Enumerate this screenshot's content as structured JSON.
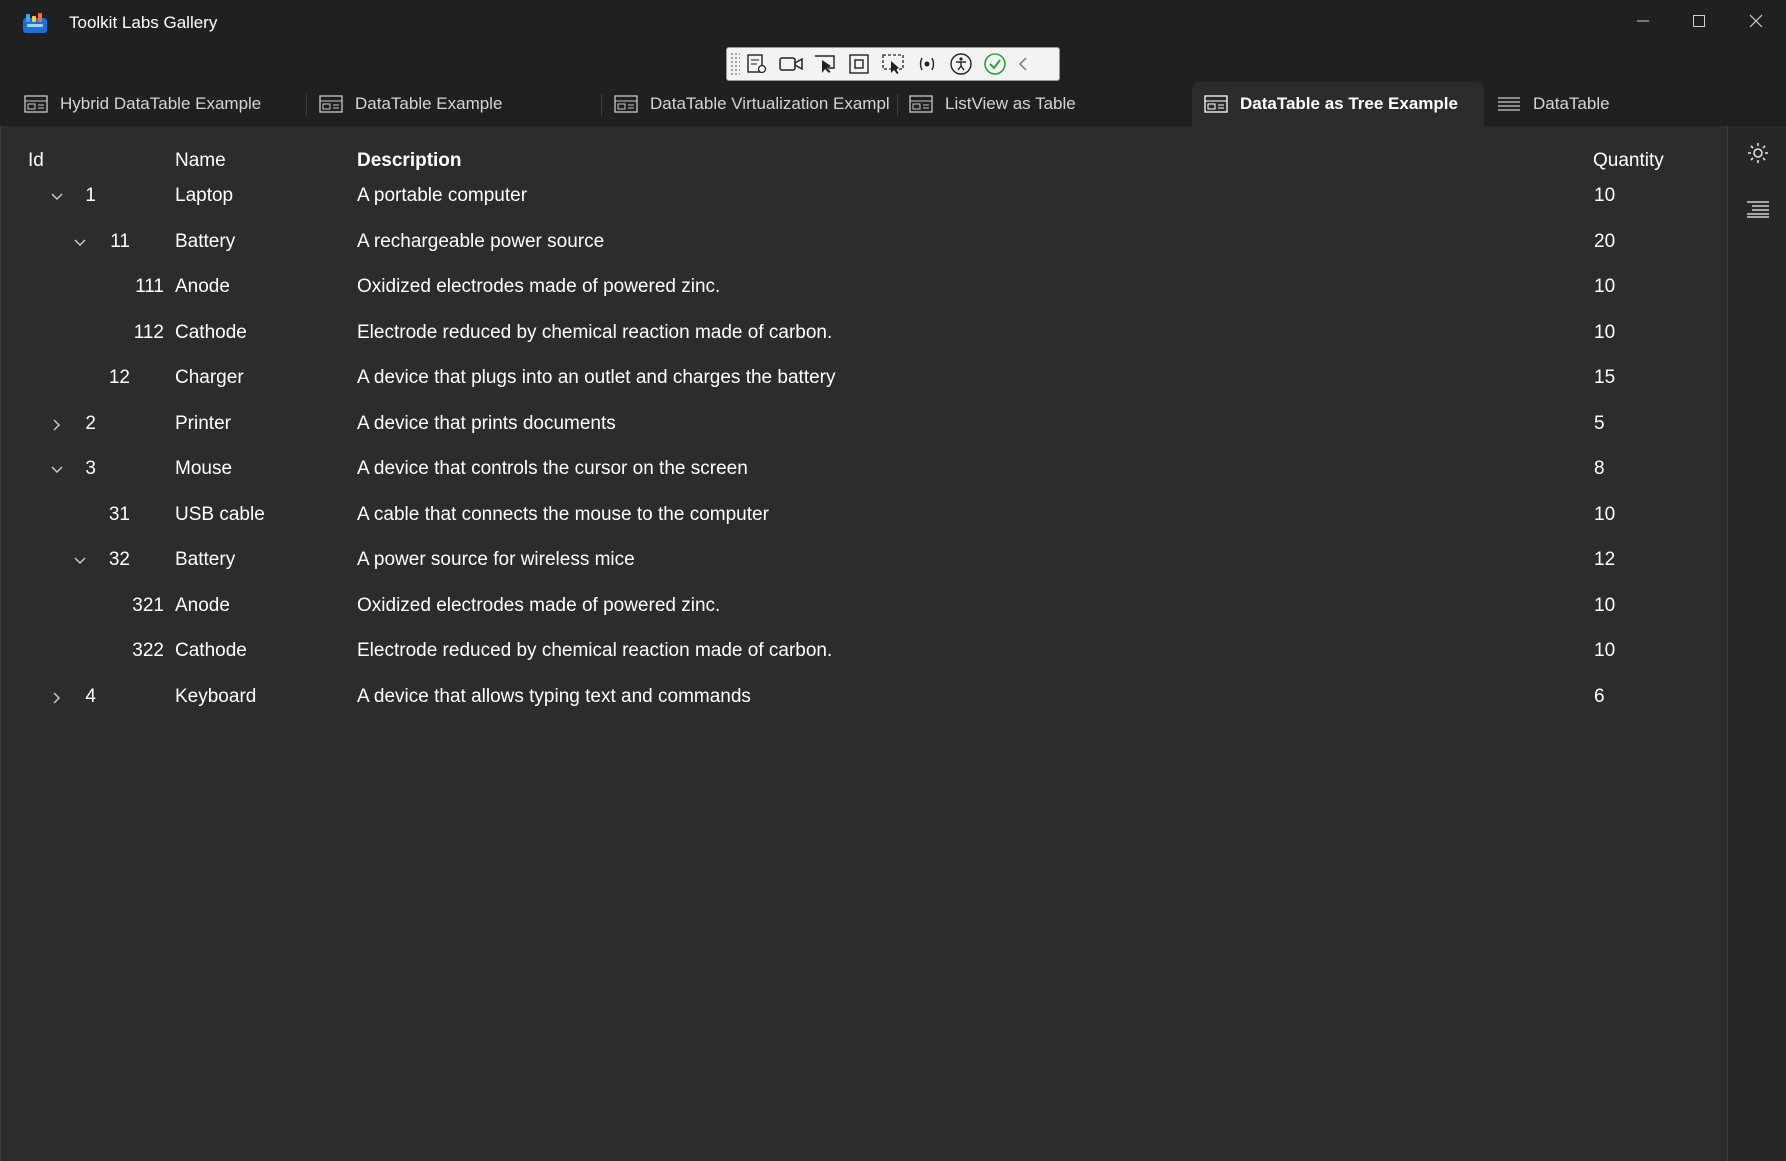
{
  "window": {
    "title": "Toolkit Labs Gallery",
    "controls": [
      "minimize",
      "maximize",
      "close"
    ]
  },
  "devtools": {
    "tools": [
      "select-element-icon",
      "record-icon",
      "pointer-icon",
      "frame-icon",
      "focus-icon",
      "binding-icon",
      "accessibility-icon",
      "check-icon",
      "collapse-icon"
    ]
  },
  "tabs": [
    {
      "label": "Hybrid DataTable Example",
      "icon": "table-icon",
      "active": false
    },
    {
      "label": "DataTable Example",
      "icon": "table-icon",
      "active": false
    },
    {
      "label": "DataTable Virtualization Example",
      "icon": "table-icon",
      "active": false
    },
    {
      "label": "ListView as Table",
      "icon": "table-icon",
      "active": false
    },
    {
      "label": "DataTable as Tree Example",
      "icon": "table-icon",
      "active": true
    },
    {
      "label": "DataTable",
      "icon": "lines-icon",
      "active": false
    }
  ],
  "table": {
    "headers": {
      "id": "Id",
      "name": "Name",
      "description": "Description",
      "quantity": "Quantity"
    },
    "rows": [
      {
        "level": 0,
        "expander": "expanded",
        "id": "1",
        "name": "Laptop",
        "description": "A portable computer",
        "quantity": "10"
      },
      {
        "level": 1,
        "expander": "expanded",
        "id": "11",
        "name": "Battery",
        "description": "A rechargeable power source",
        "quantity": "20"
      },
      {
        "level": 2,
        "expander": "none",
        "id": "111",
        "name": "Anode",
        "description": "Oxidized electrodes made of powered zinc.",
        "quantity": "10"
      },
      {
        "level": 2,
        "expander": "none",
        "id": "112",
        "name": "Cathode",
        "description": "Electrode reduced by chemical reaction made of carbon.",
        "quantity": "10"
      },
      {
        "level": 1,
        "expander": "none",
        "id": "12",
        "name": "Charger",
        "description": "A device that plugs into an outlet and charges the battery",
        "quantity": "15"
      },
      {
        "level": 0,
        "expander": "collapsed",
        "id": "2",
        "name": "Printer",
        "description": "A device that prints documents",
        "quantity": "5"
      },
      {
        "level": 0,
        "expander": "expanded",
        "id": "3",
        "name": "Mouse",
        "description": "A device that controls the cursor on the screen",
        "quantity": "8"
      },
      {
        "level": 1,
        "expander": "none",
        "id": "31",
        "name": "USB cable",
        "description": "A cable that connects the mouse to the computer",
        "quantity": "10"
      },
      {
        "level": 1,
        "expander": "expanded",
        "id": "32",
        "name": "Battery",
        "description": "A power source for wireless mice",
        "quantity": "12"
      },
      {
        "level": 2,
        "expander": "none",
        "id": "321",
        "name": "Anode",
        "description": "Oxidized electrodes made of powered zinc.",
        "quantity": "10"
      },
      {
        "level": 2,
        "expander": "none",
        "id": "322",
        "name": "Cathode",
        "description": "Electrode reduced by chemical reaction made of carbon.",
        "quantity": "10"
      },
      {
        "level": 0,
        "expander": "collapsed",
        "id": "4",
        "name": "Keyboard",
        "description": "A device that allows typing text and commands",
        "quantity": "6"
      }
    ]
  },
  "side_panel": {
    "buttons": [
      "theme-toggle-icon",
      "flow-direction-icon"
    ]
  },
  "colors": {
    "background": "#202020",
    "content": "#2c2c2c",
    "text": "#ffffff",
    "accent_check": "#2ea043"
  }
}
